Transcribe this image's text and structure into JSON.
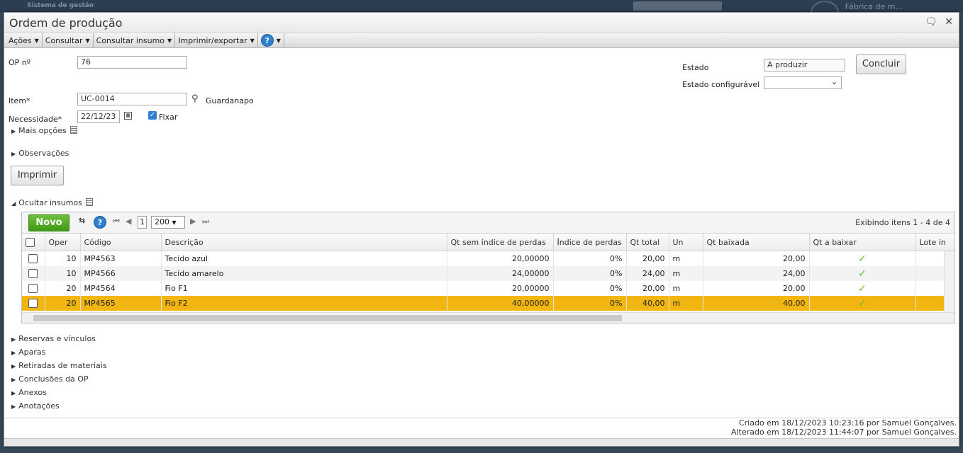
{
  "background": {
    "app_name": "Sistema de gestão",
    "company": "Fábrica de m..."
  },
  "window": {
    "title": "Ordem de produção"
  },
  "toolbar": {
    "items": [
      "Ações",
      "Consultar",
      "Consultar insumo",
      "Imprimir/exportar"
    ],
    "help_glyph": "?"
  },
  "form": {
    "op_label": "OP nº",
    "op_value": "76",
    "item_label": "Item*",
    "item_value": "UC-0014",
    "item_desc": "Guardanapo",
    "necessidade_label": "Necessidade*",
    "necessidade_value": "22/12/23",
    "fixar_label": "Fixar",
    "mais_opcoes": "Mais opções",
    "observacoes": "Observações",
    "imprimir": "Imprimir",
    "estado_label": "Estado",
    "estado_value": "A produzir",
    "estado_config_label": "Estado configurável",
    "estado_config_value": "",
    "concluir": "Concluir"
  },
  "insumos": {
    "toggle_label": "Ocultar insumos",
    "novo": "Novo",
    "page": "1",
    "page_size": "200",
    "info": "Exibindo itens 1 - 4 de 4",
    "columns": [
      "Oper",
      "Código",
      "Descrição",
      "Qt sem índice de perdas",
      "Índice de perdas",
      "Qt total",
      "Un",
      "Qt baixada",
      "Qt a baixar",
      "Lote in"
    ],
    "rows": [
      {
        "oper": "10",
        "codigo": "MP4563",
        "descricao": "Tecido azul",
        "qt_sem": "20,00000",
        "indice": "0%",
        "qt_total": "20,00",
        "un": "m",
        "qt_baixada": "20,00"
      },
      {
        "oper": "10",
        "codigo": "MP4566",
        "descricao": "Tecido amarelo",
        "qt_sem": "24,00000",
        "indice": "0%",
        "qt_total": "24,00",
        "un": "m",
        "qt_baixada": "24,00"
      },
      {
        "oper": "20",
        "codigo": "MP4564",
        "descricao": "Fio F1",
        "qt_sem": "20,00000",
        "indice": "0%",
        "qt_total": "20,00",
        "un": "m",
        "qt_baixada": "20,00"
      },
      {
        "oper": "20",
        "codigo": "MP4565",
        "descricao": "Fio F2",
        "qt_sem": "40,00000",
        "indice": "0%",
        "qt_total": "40,00",
        "un": "m",
        "qt_baixada": "40,00"
      }
    ]
  },
  "sections": [
    "Reservas e vínculos",
    "Aparas",
    "Retiradas de materiais",
    "Conclusões da OP",
    "Anexos",
    "Anotações"
  ],
  "footer": {
    "created": "Criado em 18/12/2023 10:23:16 por Samuel Gonçalves.",
    "altered": "Alterado em 18/12/2023 11:44:07 por Samuel Gonçalves."
  },
  "colors": {
    "selected_row": "#f1b611",
    "novo_button": "#4fa823",
    "check": "#6dbf2a"
  }
}
